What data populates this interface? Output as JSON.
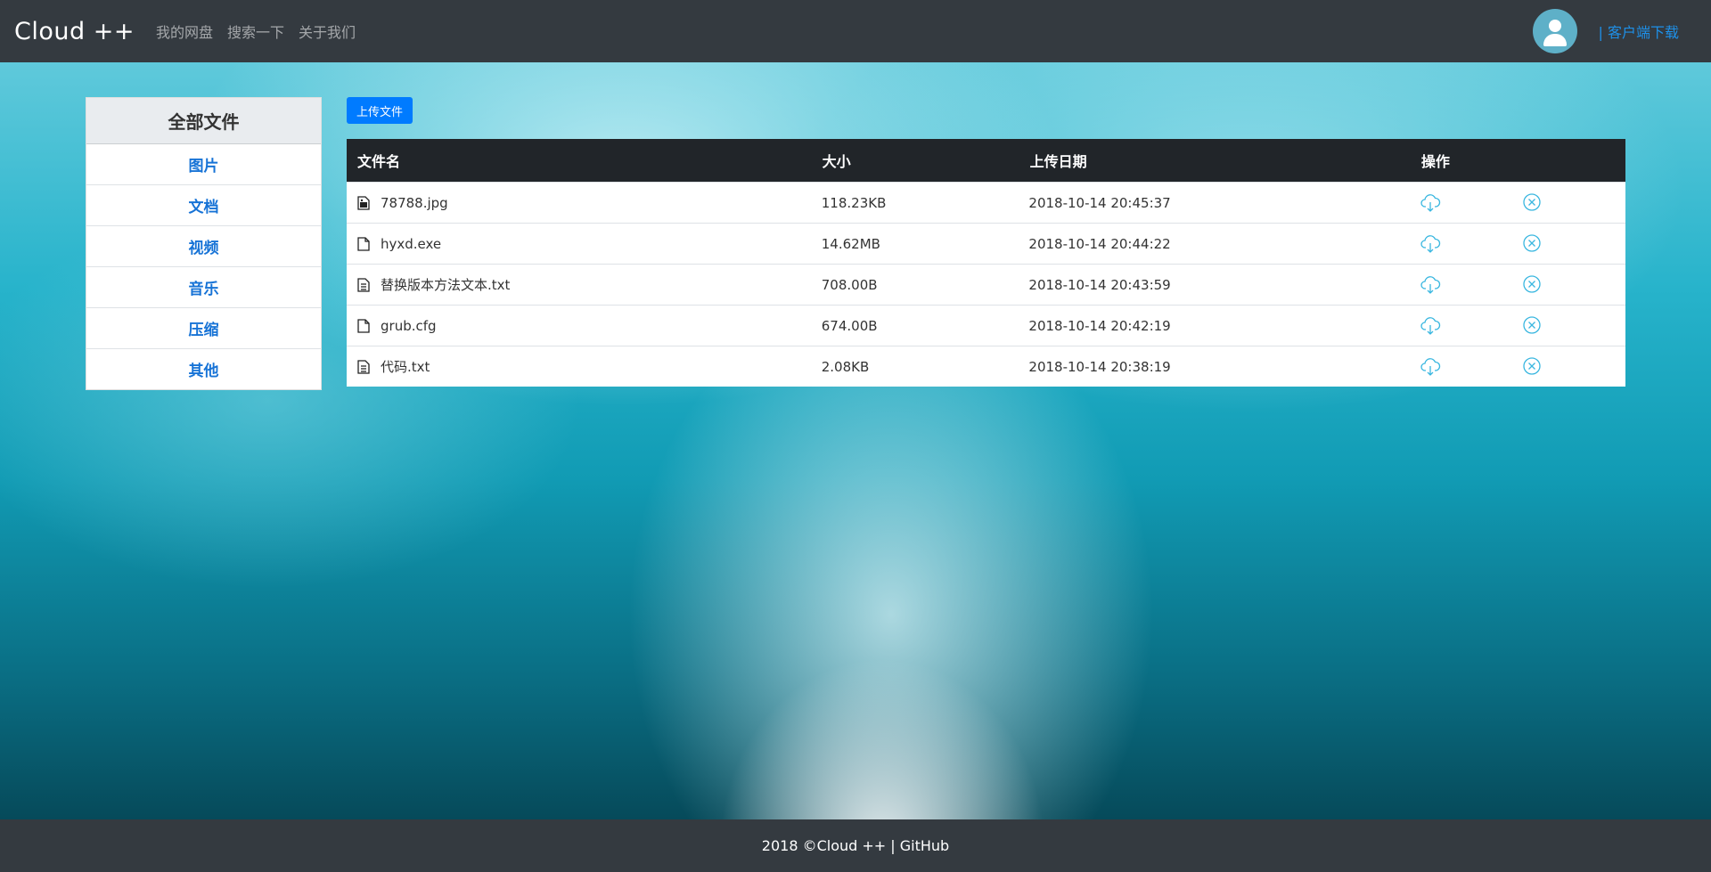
{
  "brand": "Cloud ++",
  "nav": {
    "links": [
      "我的网盘",
      "搜索一下",
      "关于我们"
    ],
    "client_download": "| 客户端下载"
  },
  "sidebar": {
    "title": "全部文件",
    "items": [
      "图片",
      "文档",
      "视频",
      "音乐",
      "压缩",
      "其他"
    ]
  },
  "toolbar": {
    "upload_label": "上传文件"
  },
  "table": {
    "headers": {
      "name": "文件名",
      "size": "大小",
      "date": "上传日期",
      "op": "操作"
    },
    "rows": [
      {
        "icon": "image-file-icon",
        "name": "78788.jpg",
        "size": "118.23KB",
        "date": "2018-10-14 20:45:37"
      },
      {
        "icon": "file-icon",
        "name": "hyxd.exe",
        "size": "14.62MB",
        "date": "2018-10-14 20:44:22"
      },
      {
        "icon": "text-file-icon",
        "name": "替换版本方法文本.txt",
        "size": "708.00B",
        "date": "2018-10-14 20:43:59"
      },
      {
        "icon": "file-icon",
        "name": "grub.cfg",
        "size": "674.00B",
        "date": "2018-10-14 20:42:19"
      },
      {
        "icon": "text-file-icon",
        "name": "代码.txt",
        "size": "2.08KB",
        "date": "2018-10-14 20:38:19"
      }
    ]
  },
  "footer": {
    "text": "2018 ©Cloud ++ | GitHub"
  },
  "colors": {
    "accent": "#007bff",
    "navbar": "#343a40",
    "icon": "#3ab7e0"
  }
}
